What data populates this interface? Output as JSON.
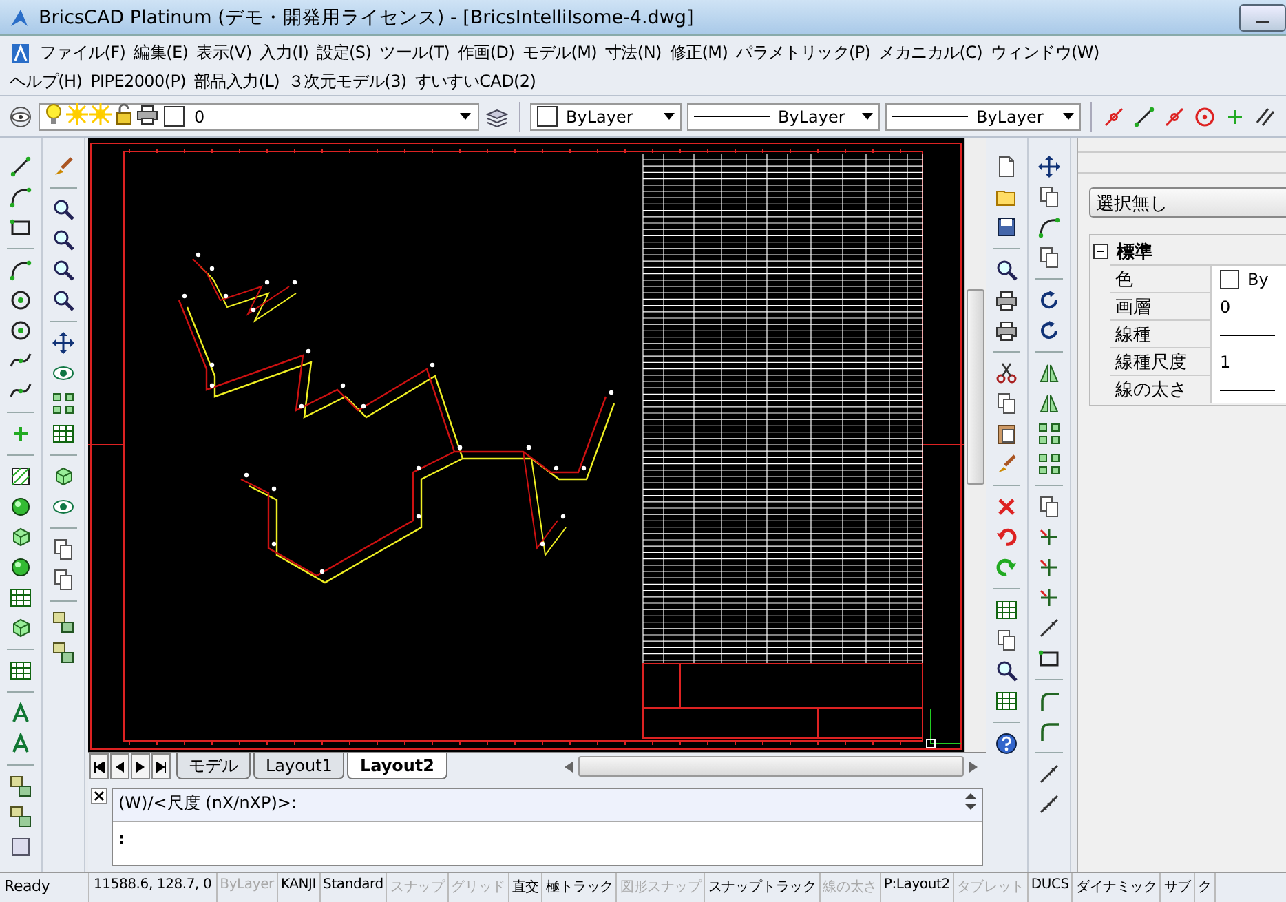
{
  "window": {
    "title": "BricsCAD Platinum (デモ・開発用ライセンス) - [BricsIntelliIsome-4.dwg]"
  },
  "menu": [
    "ファイル(F)",
    "編集(E)",
    "表示(V)",
    "入力(I)",
    "設定(S)",
    "ツール(T)",
    "作画(D)",
    "モデル(M)",
    "寸法(N)",
    "修正(M)",
    "パラメトリック(P)",
    "メカニカル(C)",
    "ウィンドウ(W)",
    "ヘルプ(H)",
    "PIPE2000(P)",
    "部品入力(L)",
    "３次元モデル(3)",
    "すいすいCAD(2)"
  ],
  "layer_toolbar": {
    "layer": "0",
    "color_setting": "ByLayer",
    "linetype": "ByLayer",
    "lineweight": "ByLayer"
  },
  "layout_tabs": [
    {
      "label": "モデル",
      "selected": false
    },
    {
      "label": "Layout1",
      "selected": false
    },
    {
      "label": "Layout2",
      "selected": true
    }
  ],
  "properties": {
    "selection": "選択無し",
    "section": {
      "title": "標準",
      "expanded": true,
      "rows": [
        {
          "name": "色",
          "kind": "swatch",
          "value": "By"
        },
        {
          "name": "画層",
          "kind": "text",
          "value": "0"
        },
        {
          "name": "線種",
          "kind": "line"
        },
        {
          "name": "線種尺度",
          "kind": "text",
          "value": "1"
        },
        {
          "name": "線の太さ",
          "kind": "line"
        }
      ]
    }
  },
  "command_line": {
    "history": "(W)/<尺度 (nX/nXP)>:",
    "prompt": ":"
  },
  "status_bar": {
    "message": "Ready",
    "coordinates": "11588.6, 128.7, 0",
    "toggles": [
      {
        "label": "ByLayer",
        "on": false
      },
      {
        "label": "KANJI",
        "on": true
      },
      {
        "label": "Standard",
        "on": true
      },
      {
        "label": "スナップ",
        "on": false
      },
      {
        "label": "グリッド",
        "on": false
      },
      {
        "label": "直交",
        "on": true
      },
      {
        "label": "極トラック",
        "on": true
      },
      {
        "label": "図形スナップ",
        "on": false
      },
      {
        "label": "スナップトラック",
        "on": true
      },
      {
        "label": "線の太さ",
        "on": false
      },
      {
        "label": "P:Layout2",
        "on": true
      },
      {
        "label": "タブレット",
        "on": false
      },
      {
        "label": "DUCS",
        "on": true
      },
      {
        "label": "ダイナミック",
        "on": true
      },
      {
        "label": "サブ",
        "on": true
      },
      {
        "label": "ク",
        "on": true
      }
    ]
  }
}
